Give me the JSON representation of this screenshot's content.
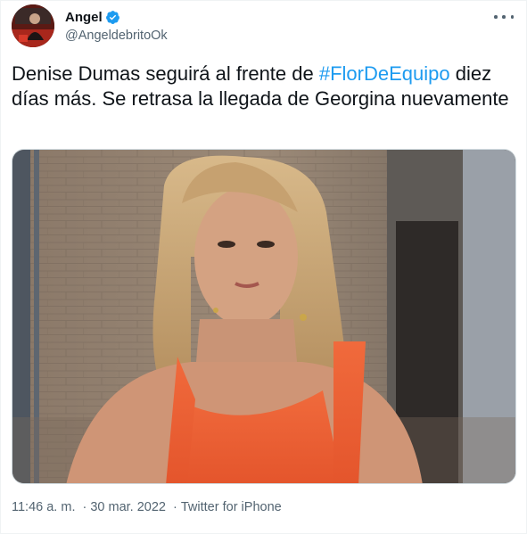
{
  "author": {
    "display_name": "Angel",
    "handle": "@AngeldebritoOk",
    "verified": true
  },
  "tweet": {
    "text_before": "Denise Dumas seguirá al frente de ",
    "hashtag": "#FlorDeEquipo",
    "text_after": " diez días más.  Se retrasa la llegada de Georgina nuevamente"
  },
  "meta": {
    "time": "11:46 a. m.",
    "date": "30 mar. 2022",
    "client": "Twitter for iPhone",
    "separator": "·"
  },
  "colors": {
    "link": "#1d9bf0",
    "secondary_text": "#536471",
    "primary_text": "#0f1419"
  },
  "icons": {
    "verified": "verified-badge-icon",
    "more": "more-options-icon"
  }
}
